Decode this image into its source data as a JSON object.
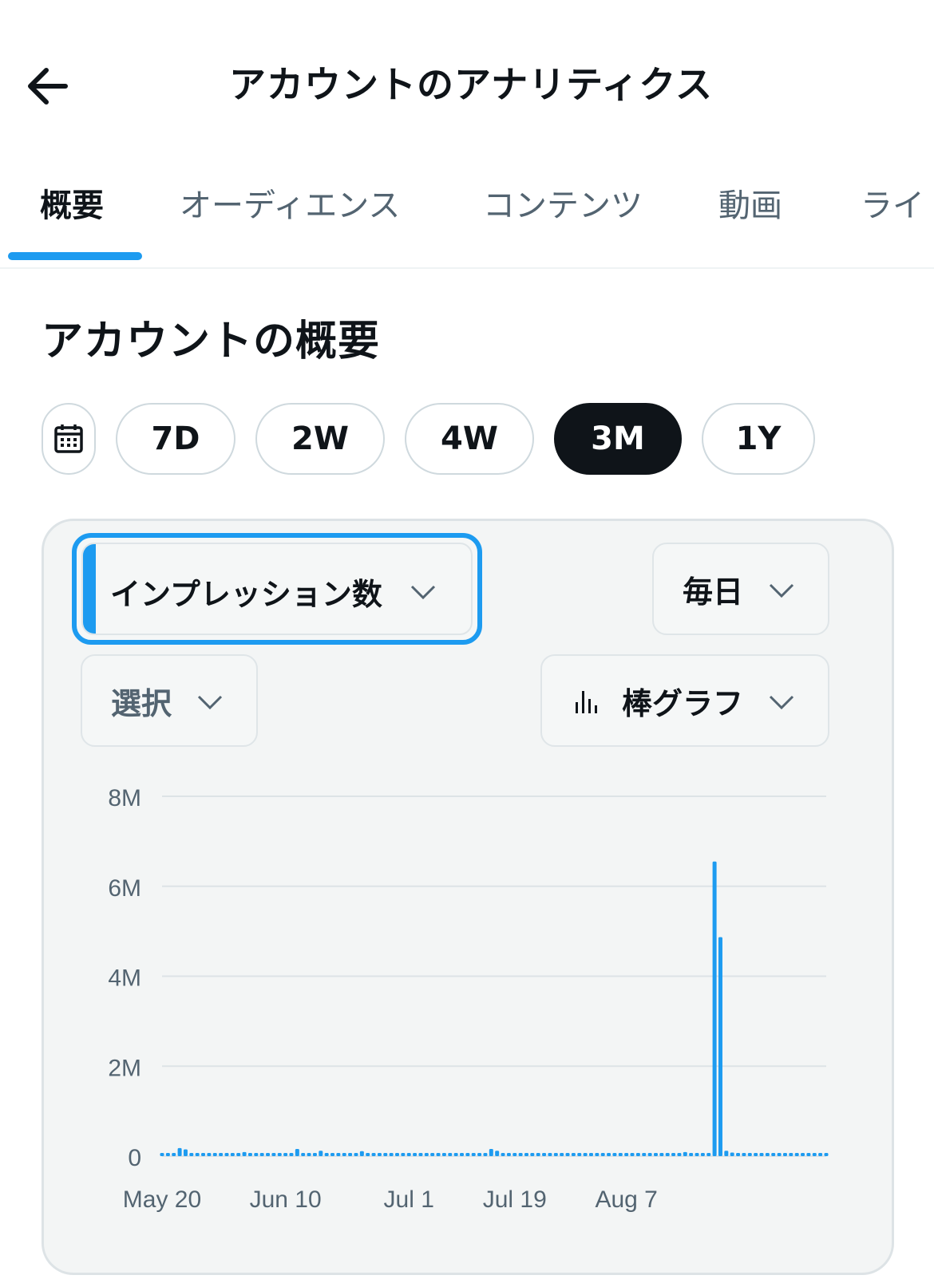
{
  "header": {
    "title": "アカウントのアナリティクス"
  },
  "tabs": [
    {
      "label": "概要",
      "active": true
    },
    {
      "label": "オーディエンス",
      "active": false
    },
    {
      "label": "コンテンツ",
      "active": false
    },
    {
      "label": "動画",
      "active": false
    },
    {
      "label": "ライ",
      "active": false
    }
  ],
  "section": {
    "title": "アカウントの概要"
  },
  "ranges": [
    {
      "label": "7D",
      "active": false
    },
    {
      "label": "2W",
      "active": false
    },
    {
      "label": "4W",
      "active": false
    },
    {
      "label": "3M",
      "active": true
    },
    {
      "label": "1Y",
      "active": false
    }
  ],
  "controls": {
    "metric": "インプレッション数",
    "interval": "毎日",
    "compare": "選択",
    "chart_type": "棒グラフ"
  },
  "colors": {
    "accent": "#1d9bf0",
    "dark": "#0f1419",
    "muted": "#536471"
  },
  "icons": [
    "back-arrow-icon",
    "calendar-icon",
    "chevron-down-icon",
    "bar-chart-icon"
  ],
  "chart_data": {
    "type": "bar",
    "ylabel": "",
    "xlabel": "",
    "ylim": [
      0,
      8000000
    ],
    "y_ticks": [
      "8M",
      "6M",
      "4M",
      "2M",
      "0"
    ],
    "y_tick_values": [
      8000000,
      6000000,
      4000000,
      2000000,
      0
    ],
    "x_ticks": [
      {
        "label": "May 20",
        "index": 0
      },
      {
        "label": "Jun 10",
        "index": 21
      },
      {
        "label": "Jul 1",
        "index": 42
      },
      {
        "label": "Jul 19",
        "index": 60
      },
      {
        "label": "Aug 7",
        "index": 79
      }
    ],
    "start_label": "May 20",
    "values": [
      50000,
      40000,
      50000,
      180000,
      150000,
      60000,
      50000,
      40000,
      40000,
      40000,
      40000,
      40000,
      40000,
      40000,
      90000,
      40000,
      40000,
      40000,
      40000,
      40000,
      40000,
      40000,
      40000,
      160000,
      40000,
      40000,
      40000,
      120000,
      40000,
      40000,
      40000,
      40000,
      40000,
      50000,
      110000,
      40000,
      40000,
      40000,
      40000,
      40000,
      40000,
      40000,
      40000,
      40000,
      40000,
      40000,
      40000,
      40000,
      40000,
      40000,
      40000,
      40000,
      40000,
      40000,
      40000,
      40000,
      160000,
      120000,
      40000,
      40000,
      40000,
      40000,
      40000,
      40000,
      40000,
      40000,
      40000,
      40000,
      40000,
      40000,
      40000,
      40000,
      40000,
      40000,
      40000,
      40000,
      40000,
      40000,
      40000,
      40000,
      40000,
      40000,
      40000,
      40000,
      40000,
      40000,
      40000,
      40000,
      40000,
      90000,
      40000,
      40000,
      40000,
      40000,
      6550000,
      4870000,
      120000,
      80000,
      60000,
      60000,
      40000,
      60000,
      40000,
      40000,
      70000,
      40000,
      40000,
      40000,
      40000,
      40000,
      40000,
      40000,
      70000,
      40000
    ]
  }
}
